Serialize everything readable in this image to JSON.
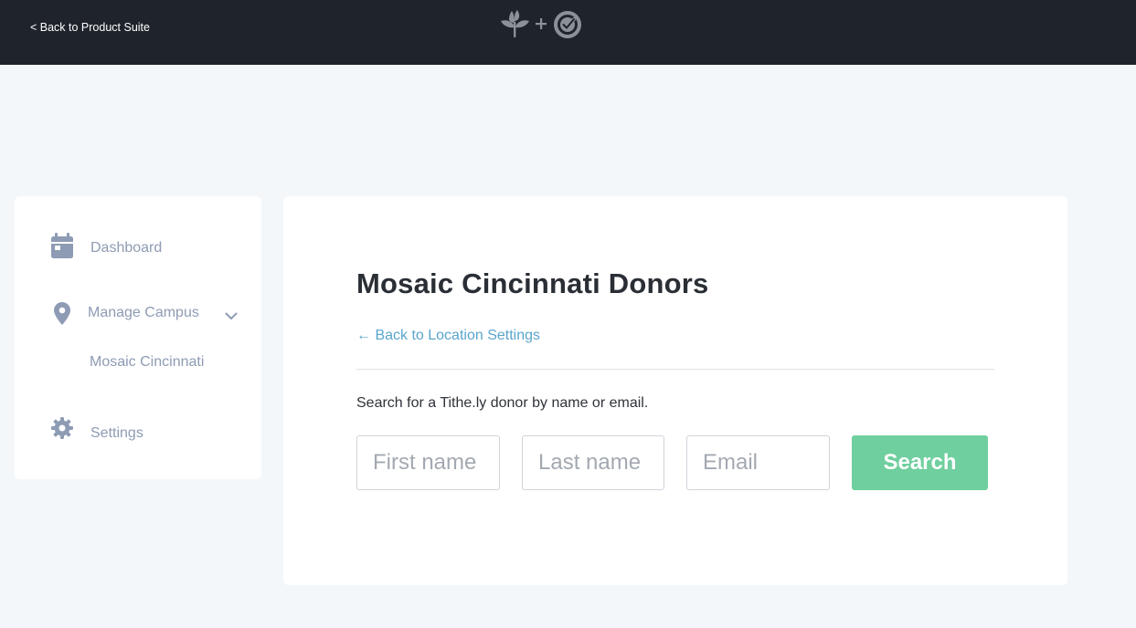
{
  "header": {
    "back_link": "< Back to Product Suite",
    "logo_icons": [
      "sprout-icon",
      "plus-icon",
      "target-check-icon"
    ]
  },
  "sidebar": {
    "items": [
      {
        "label": "Dashboard",
        "icon": "calendar-icon"
      },
      {
        "label": "Manage Campus",
        "icon": "map-pin-icon",
        "expanded": true,
        "children": [
          {
            "label": "Mosaic Cincinnati"
          }
        ]
      },
      {
        "label": "Settings",
        "icon": "gear-icon"
      }
    ]
  },
  "main": {
    "title": "Mosaic Cincinnati Donors",
    "back_link": "← Back to Location Settings",
    "instructions": "Search for a Tithe.ly donor by name or email.",
    "form": {
      "first_name_placeholder": "First name",
      "last_name_placeholder": "Last name",
      "email_placeholder": "Email",
      "search_label": "Search"
    }
  },
  "colors": {
    "topbar": "#1f232c",
    "page_background": "#f4f7fa",
    "link": "#5aa5cc",
    "search_button": "#6fcf9e",
    "sidebar_text": "#8e9bb4"
  }
}
